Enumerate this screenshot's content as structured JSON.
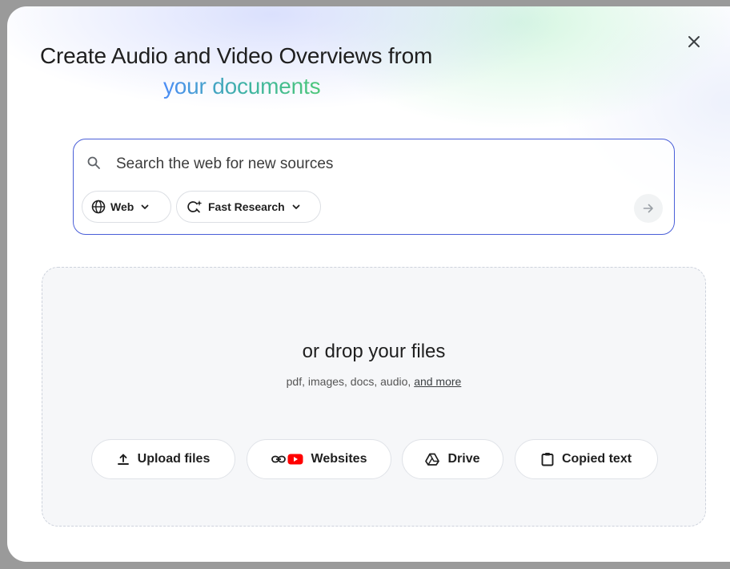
{
  "dialog": {
    "title_line1": "Create Audio and Video Overviews from",
    "title_line2": "your documents",
    "close_icon": "close-icon"
  },
  "search": {
    "placeholder": "Search the web for new sources",
    "value": "",
    "source_chip": {
      "label": "Web",
      "icon": "globe-icon"
    },
    "mode_chip": {
      "label": "Fast Research",
      "icon": "sparkle-search-icon"
    },
    "submit_icon": "arrow-right-icon"
  },
  "drop_zone": {
    "title": "or drop your files",
    "subtitle": "pdf, images, docs, audio, ",
    "more_link": "and more",
    "buttons": [
      {
        "label": "Upload files",
        "icon": "upload-icon"
      },
      {
        "label": "Websites",
        "icon": "link-youtube-icon"
      },
      {
        "label": "Drive",
        "icon": "drive-icon"
      },
      {
        "label": "Copied text",
        "icon": "clipboard-icon"
      }
    ]
  },
  "colors": {
    "accent_border": "#4a5fd8",
    "title_gradient_start": "#4c8df6",
    "title_gradient_end": "#4ec77a",
    "youtube_red": "#ff0000"
  }
}
